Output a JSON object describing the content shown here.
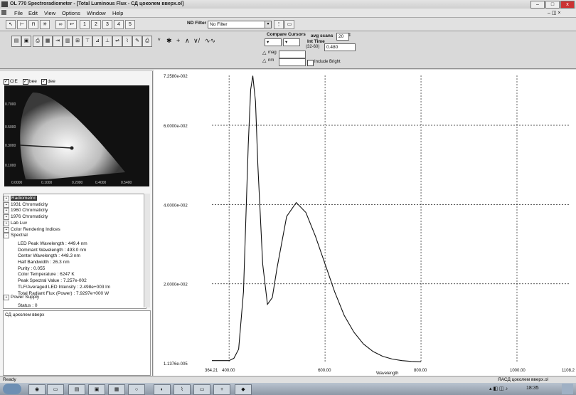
{
  "window": {
    "title": "OL 770 Spectroradiometer - [Total Luminous Flux - СД цоколем вверх.ol]"
  },
  "menu": [
    "File",
    "Edit",
    "View",
    "Options",
    "Window",
    "Help"
  ],
  "toolbar1": {
    "numbers": [
      "1",
      "2",
      "3",
      "4",
      "5"
    ],
    "nd_filter_label": "ND Filter",
    "nd_filter_value": "No Filter"
  },
  "toolbar2": {
    "compare_cursors_label": "Compare Cursors",
    "avg_scans_label": "avg scans",
    "avg_scans_value": "20",
    "int_time_label": "Int Time",
    "int_time_unit": "(32-60)",
    "int_time_value": "0.480",
    "mag_label": "mag",
    "nm_label": "nm",
    "include_label": "Include Bright"
  },
  "cie": {
    "checks": [
      {
        "label": "CIE",
        "checked": true
      },
      {
        "label": "bee",
        "checked": true
      },
      {
        "label": "dee",
        "checked": true
      }
    ],
    "y_ticks": [
      "0.7000",
      "0.5000",
      "0.3000",
      "0.1000"
    ],
    "x_ticks": [
      "0.0000",
      "0.1000",
      "0.2000",
      "0.4000",
      "0.5400"
    ]
  },
  "tree": {
    "items": [
      {
        "label": "Radiometric",
        "expander": "+",
        "level": 0,
        "selected": true
      },
      {
        "label": "1931 Chromaticity",
        "expander": "+",
        "level": 0
      },
      {
        "label": "1960 Chromaticity",
        "expander": "+",
        "level": 0
      },
      {
        "label": "1976 Chromaticity",
        "expander": "+",
        "level": 0
      },
      {
        "label": "Lab Luv",
        "expander": "+",
        "level": 0
      },
      {
        "label": "Color Rendering Indices",
        "expander": "+",
        "level": 0
      },
      {
        "label": "Spectral",
        "expander": "-",
        "level": 0
      },
      {
        "label": "LED Peak Wavelength : 449.4 nm",
        "expander": "",
        "level": 1
      },
      {
        "label": "Dominant Wavelength : 493.0 nm",
        "expander": "",
        "level": 1
      },
      {
        "label": "Center Wavelength : 448.3 nm",
        "expander": "",
        "level": 1
      },
      {
        "label": "Half Bandwidth : 26.3 nm",
        "expander": "",
        "level": 1
      },
      {
        "label": "Purity : 0.055",
        "expander": "",
        "level": 1
      },
      {
        "label": "Color Temperature : 6247 K",
        "expander": "",
        "level": 1
      },
      {
        "label": "Peak Spectral Value : 7.257e-002",
        "expander": "",
        "level": 1
      },
      {
        "label": "TLF/Averaged LED Intensity : 2.498e+003 lm",
        "expander": "",
        "level": 1
      },
      {
        "label": "Total Radiant Flux (Power) : 7.9297e+000 W",
        "expander": "",
        "level": 1
      },
      {
        "label": "Power Supply",
        "expander": "+",
        "level": 0
      },
      {
        "label": "Status : 0",
        "expander": "",
        "level": 1
      }
    ]
  },
  "note": "СД цоколем вверх",
  "chart_data": {
    "type": "line",
    "xlabel": "Wavelength",
    "ylabel": "",
    "xlim": [
      364.21,
      1108.2
    ],
    "ylim": [
      1.1376e-05,
      0.07258
    ],
    "x_tick_labels": [
      "364.21",
      "400.00",
      "600.00",
      "800.00",
      "1000.00",
      "1108.2"
    ],
    "y_tick_labels": [
      "7.2580e-002",
      "6.0000e-002",
      "4.0000e-002",
      "2.0000e-002",
      "1.1376e-005"
    ],
    "grid": true,
    "series": [
      {
        "x": [
          364.21,
          380,
          400,
          410,
          420,
          430,
          440,
          445,
          449.4,
          455,
          460,
          470,
          480,
          490,
          500,
          520,
          540,
          560,
          580,
          600,
          620,
          640,
          660,
          680,
          700,
          720,
          740,
          760,
          780,
          800
        ],
        "y": [
          0.0006,
          0.0006,
          0.0006,
          0.0012,
          0.0035,
          0.018,
          0.055,
          0.069,
          0.0725,
          0.066,
          0.05,
          0.025,
          0.0148,
          0.0165,
          0.024,
          0.037,
          0.0405,
          0.038,
          0.032,
          0.025,
          0.018,
          0.012,
          0.0078,
          0.0048,
          0.0029,
          0.0017,
          0.001,
          0.0006,
          0.0004,
          0.0003
        ]
      }
    ]
  },
  "status": {
    "left": "Ready",
    "right": "ЯАСД цоколем вверх.ol"
  },
  "taskbar": {
    "time": "18:35"
  }
}
